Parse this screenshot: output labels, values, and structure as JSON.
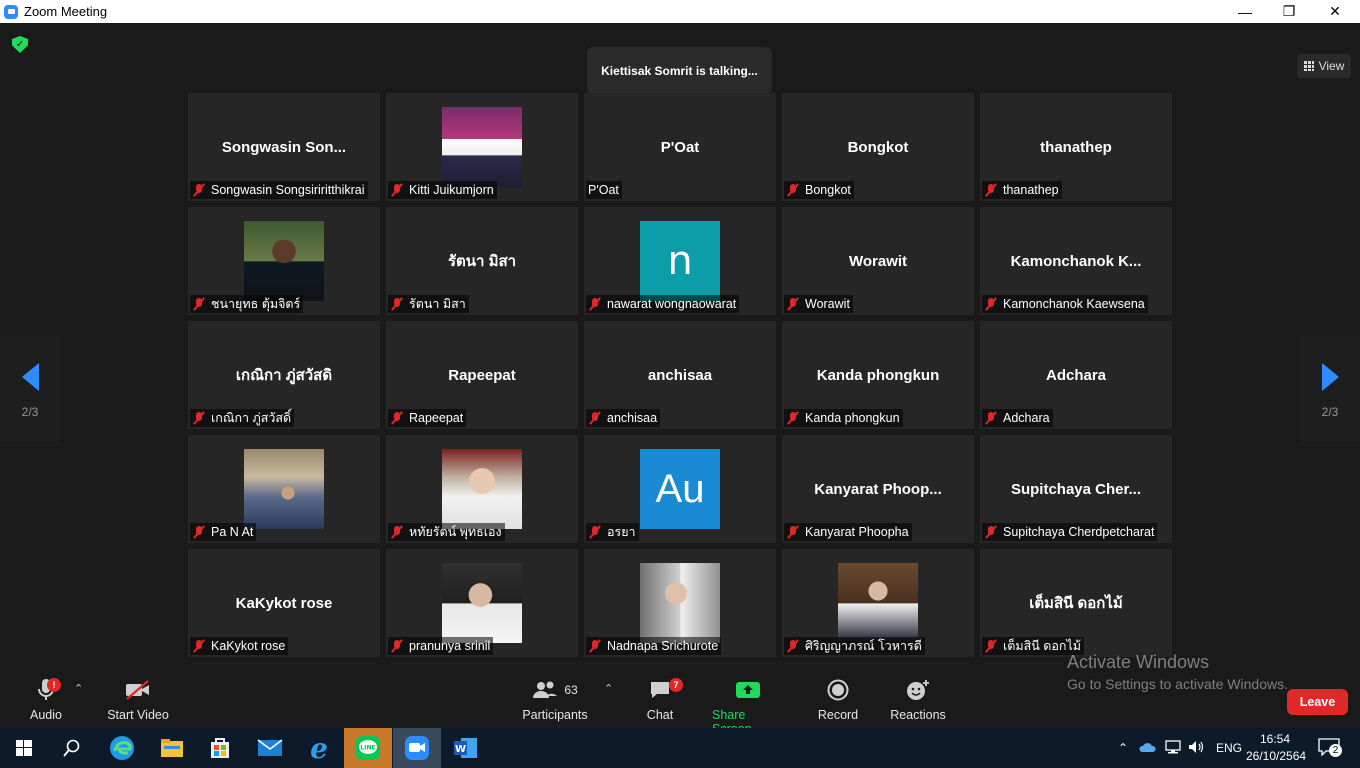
{
  "window": {
    "title": "Zoom Meeting",
    "minimize": "—",
    "maximize": "❐",
    "close": "✕"
  },
  "talking": "Kiettisak Somrit is talking...",
  "view_label": "View",
  "pages": {
    "left": "2/3",
    "right": "2/3"
  },
  "tiles": [
    {
      "big": "Songwasin  Son...",
      "label": "Songwasin Songsiriritthikrai"
    },
    {
      "big": "",
      "label": "Kitti Juikumjorn"
    },
    {
      "big": "P'Oat",
      "label": "P'Oat"
    },
    {
      "big": "Bongkot",
      "label": "Bongkot"
    },
    {
      "big": "thanathep",
      "label": "thanathep"
    },
    {
      "big": "",
      "label": "ชนายุทธ ตุ้มจิตร์"
    },
    {
      "big": "รัตนา มิสา",
      "label": "รัตนา มิสา"
    },
    {
      "big": "n",
      "label": "nawarat wongnaowarat"
    },
    {
      "big": "Worawit",
      "label": "Worawit"
    },
    {
      "big": "Kamonchanok  K...",
      "label": "Kamonchanok Kaewsena"
    },
    {
      "big": "เกณิกา ภู่สวัสดิ",
      "label": "เกณิกา ภู่สวัสดิ์"
    },
    {
      "big": "Rapeepat",
      "label": "Rapeepat"
    },
    {
      "big": "anchisaa",
      "label": "anchisaa"
    },
    {
      "big": "Kanda phongkun",
      "label": "Kanda phongkun"
    },
    {
      "big": "Adchara",
      "label": "Adchara"
    },
    {
      "big": "",
      "label": "Pa N At"
    },
    {
      "big": "",
      "label": "หทัยรัตน์ พุทธเอง"
    },
    {
      "big": "Au",
      "label": "อรยา"
    },
    {
      "big": "Kanyarat  Phoop...",
      "label": "Kanyarat Phoopha"
    },
    {
      "big": "Supitchaya  Cher...",
      "label": "Supitchaya Cherdpetcharat"
    },
    {
      "big": "KaKykot rose",
      "label": "KaKykot rose"
    },
    {
      "big": "",
      "label": "pranunya srinil"
    },
    {
      "big": "",
      "label": "Nadnapa Srichurote"
    },
    {
      "big": "",
      "label": "ศิริญญาภรณ์ โวหารดี"
    },
    {
      "big": "เต็มสินี ดอกไม้",
      "label": "เต็มสินี ดอกไม้"
    }
  ],
  "toolbar": {
    "audio": "Audio",
    "audio_badge": "!",
    "start_video": "Start Video",
    "participants": "Participants",
    "participants_count": "63",
    "chat": "Chat",
    "chat_badge": "7",
    "share_screen": "Share Screen",
    "record": "Record",
    "reactions": "Reactions",
    "leave": "Leave"
  },
  "watermark": {
    "line1": "Activate Windows",
    "line2": "Go to Settings to activate Windows."
  },
  "taskbar": {
    "language": "ENG",
    "time": "16:54",
    "date": "26/10/2564",
    "notifications": "2"
  },
  "colors": {
    "accent": "#2d8cff",
    "share": "#23d959",
    "leave": "#e02828",
    "bg": "#1a1a1a",
    "tile": "#262626"
  }
}
